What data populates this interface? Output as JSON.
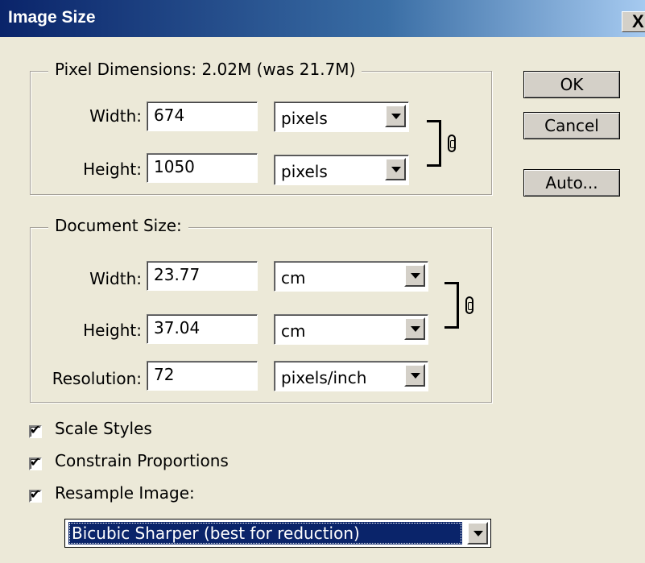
{
  "window": {
    "title": "Image Size",
    "close_glyph": "X"
  },
  "pixel_dimensions": {
    "legend": "Pixel Dimensions:  2.02M (was 21.7M)",
    "width_label": "Width:",
    "width_value": "674",
    "width_unit": "pixels",
    "height_label": "Height:",
    "height_value": "1050",
    "height_unit": "pixels"
  },
  "document_size": {
    "legend": "Document Size:",
    "width_label": "Width:",
    "width_value": "23.77",
    "width_unit": "cm",
    "height_label": "Height:",
    "height_value": "37.04",
    "height_unit": "cm",
    "resolution_label": "Resolution:",
    "resolution_value": "72",
    "resolution_unit": "pixels/inch"
  },
  "buttons": {
    "ok": "OK",
    "cancel": "Cancel",
    "auto": "Auto..."
  },
  "options": {
    "scale_styles": "Scale Styles",
    "constrain_proportions": "Constrain Proportions",
    "resample_image": "Resample Image:",
    "resample_method": "Bicubic Sharper (best for reduction)"
  },
  "icons": {
    "link_pixel": "chain-link-icon",
    "link_document": "chain-link-icon",
    "dropdown_arrow": "chevron-down-icon"
  },
  "colors": {
    "titlebar_start": "#0a246a",
    "titlebar_end": "#a6caf0",
    "dialog_bg": "#ece9d8",
    "selection_bg": "#0a246a"
  }
}
